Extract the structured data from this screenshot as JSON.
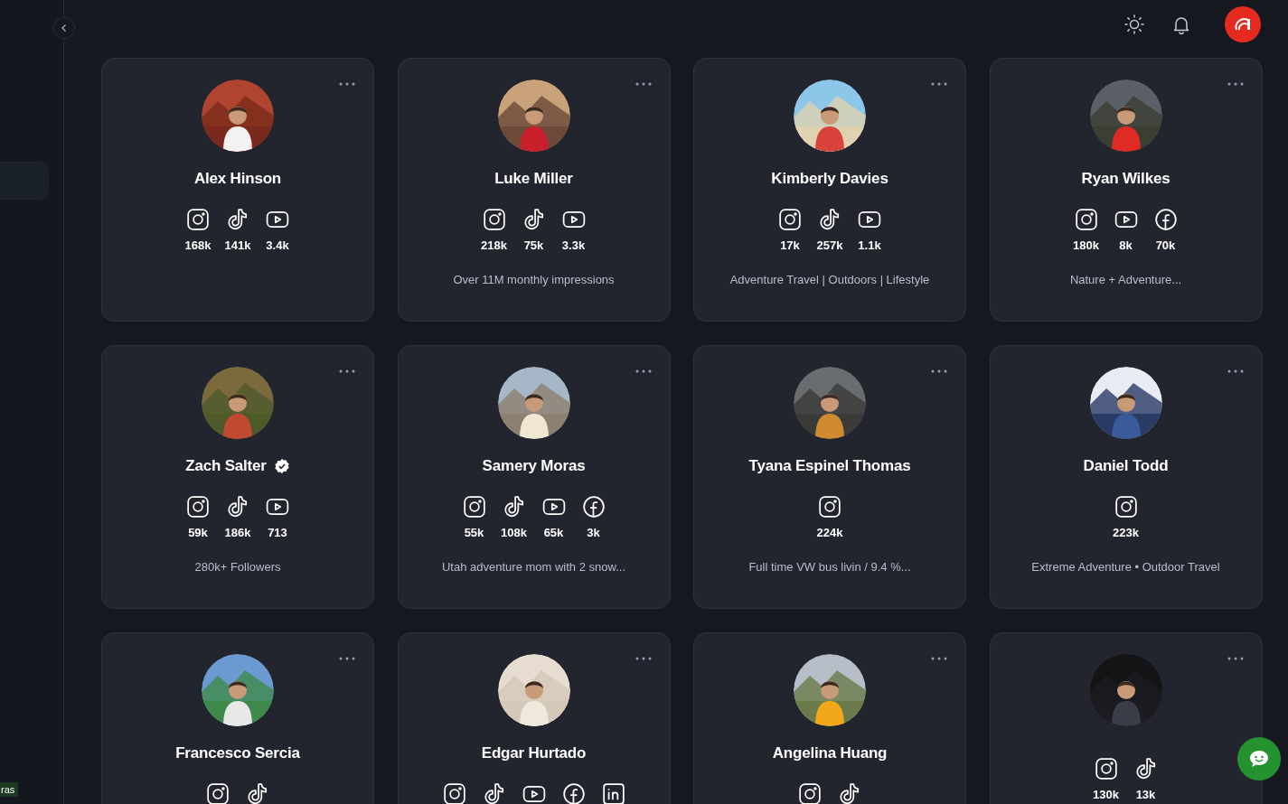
{
  "corner_tag": "ras",
  "cards": [
    {
      "name": "Alex Hinson",
      "verified": false,
      "stats": [
        {
          "kind": "instagram",
          "count": "168k"
        },
        {
          "kind": "tiktok",
          "count": "141k"
        },
        {
          "kind": "youtube",
          "count": "3.4k"
        }
      ]
    },
    {
      "name": "Luke Miller",
      "verified": false,
      "stats": [
        {
          "kind": "instagram",
          "count": "218k"
        },
        {
          "kind": "tiktok",
          "count": "75k"
        },
        {
          "kind": "youtube",
          "count": "3.3k"
        }
      ],
      "description": "Over 11M monthly impressions"
    },
    {
      "name": "Kimberly Davies",
      "verified": false,
      "stats": [
        {
          "kind": "instagram",
          "count": "17k"
        },
        {
          "kind": "tiktok",
          "count": "257k"
        },
        {
          "kind": "youtube",
          "count": "1.1k"
        }
      ],
      "description": "Adventure Travel | Outdoors | Lifestyle"
    },
    {
      "name": "Ryan Wilkes",
      "verified": false,
      "stats": [
        {
          "kind": "instagram",
          "count": "180k"
        },
        {
          "kind": "youtube",
          "count": "8k"
        },
        {
          "kind": "facebook",
          "count": "70k"
        }
      ],
      "description": "Nature + Adventure..."
    },
    {
      "name": "Zach Salter",
      "verified": true,
      "stats": [
        {
          "kind": "instagram",
          "count": "59k"
        },
        {
          "kind": "tiktok",
          "count": "186k"
        },
        {
          "kind": "youtube",
          "count": "713"
        }
      ],
      "description": "280k+ Followers"
    },
    {
      "name": "Samery Moras",
      "verified": false,
      "stats": [
        {
          "kind": "instagram",
          "count": "55k"
        },
        {
          "kind": "tiktok",
          "count": "108k"
        },
        {
          "kind": "youtube",
          "count": "65k"
        },
        {
          "kind": "facebook",
          "count": "3k"
        }
      ],
      "description": "Utah adventure mom with 2 snow..."
    },
    {
      "name": "Tyana Espinel Thomas",
      "verified": false,
      "stats": [
        {
          "kind": "instagram",
          "count": "224k"
        }
      ],
      "description": "Full time VW bus livin / 9.4 %..."
    },
    {
      "name": "Daniel Todd",
      "verified": false,
      "stats": [
        {
          "kind": "instagram",
          "count": "223k"
        }
      ],
      "description": "Extreme Adventure • Outdoor Travel"
    },
    {
      "name": "Francesco Sercia",
      "verified": false,
      "stats": [
        {
          "kind": "instagram"
        },
        {
          "kind": "tiktok"
        }
      ]
    },
    {
      "name": "Edgar Hurtado",
      "verified": false,
      "stats": [
        {
          "kind": "instagram"
        },
        {
          "kind": "tiktok"
        },
        {
          "kind": "youtube"
        },
        {
          "kind": "facebook"
        },
        {
          "kind": "linkedin"
        }
      ]
    },
    {
      "name": "Angelina Huang",
      "verified": false,
      "stats": [
        {
          "kind": "instagram"
        },
        {
          "kind": "tiktok"
        }
      ]
    },
    {
      "verified": false,
      "stats": [
        {
          "kind": "instagram",
          "count": "130k"
        },
        {
          "kind": "tiktok",
          "count": "13k"
        }
      ]
    }
  ]
}
